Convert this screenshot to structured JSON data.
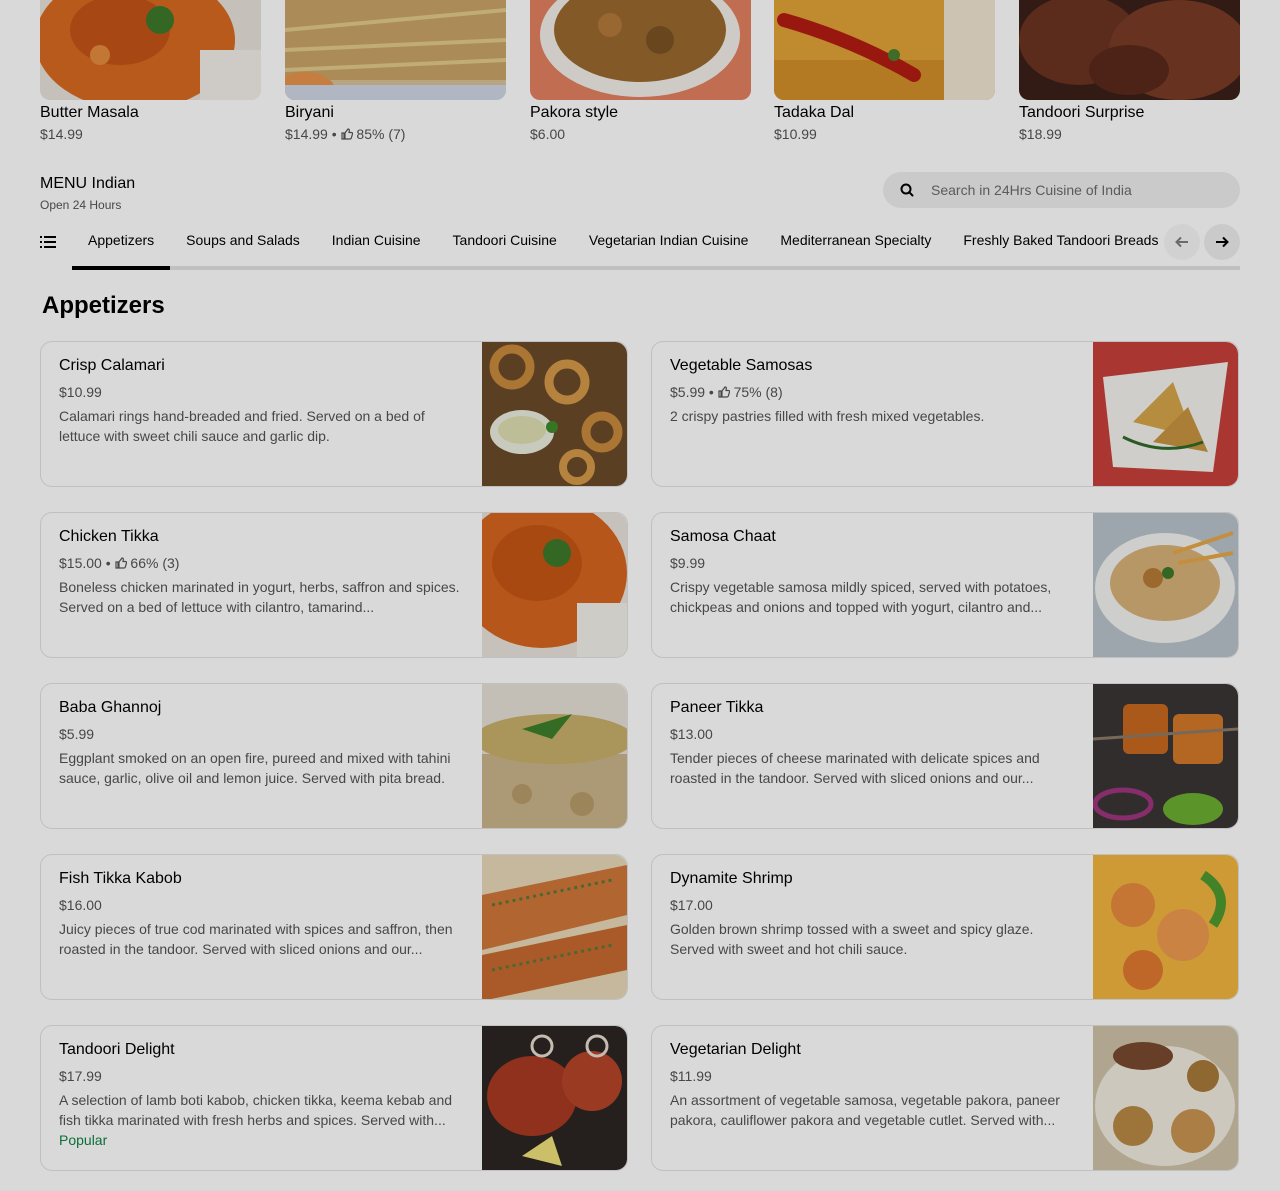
{
  "featured": [
    {
      "name": "Butter Masala",
      "meta": "$14.99",
      "rating": ""
    },
    {
      "name": "Biryani",
      "meta": "$14.99 •",
      "rating": "85% (7)"
    },
    {
      "name": "Pakora style",
      "meta": "$6.00",
      "rating": ""
    },
    {
      "name": "Tadaka Dal",
      "meta": "$10.99",
      "rating": ""
    },
    {
      "name": "Tandoori Surprise",
      "meta": "$18.99",
      "rating": ""
    }
  ],
  "menu": {
    "title": "MENU Indian",
    "hours": "Open 24 Hours",
    "search_placeholder": "Search in 24Hrs Cuisine of India"
  },
  "tabs": [
    {
      "label": "Appetizers"
    },
    {
      "label": "Soups and Salads"
    },
    {
      "label": "Indian Cuisine"
    },
    {
      "label": "Tandoori Cuisine"
    },
    {
      "label": "Vegetarian Indian Cuisine"
    },
    {
      "label": "Mediterranean Specialty"
    },
    {
      "label": "Freshly Baked Tandoori Breads"
    }
  ],
  "section": {
    "title": "Appetizers"
  },
  "items": [
    {
      "name": "Crisp Calamari",
      "price": "$10.99",
      "rating": "",
      "desc": "Calamari rings hand-breaded and fried. Served on a bed of lettuce with sweet chili sauce and garlic dip.",
      "badge": ""
    },
    {
      "name": "Vegetable Samosas",
      "price": "$5.99 •",
      "rating": "75% (8)",
      "desc": "2 crispy pastries filled with fresh mixed vegetables.",
      "badge": ""
    },
    {
      "name": "Chicken Tikka",
      "price": "$15.00 •",
      "rating": "66% (3)",
      "desc": "Boneless chicken marinated in yogurt, herbs, saffron and spices. Served on a bed of lettuce with cilantro, tamarind...",
      "badge": ""
    },
    {
      "name": "Samosa Chaat",
      "price": "$9.99",
      "rating": "",
      "desc": "Crispy vegetable samosa mildly spiced, served with potatoes, chickpeas and onions and topped with yogurt, cilantro and...",
      "badge": ""
    },
    {
      "name": "Baba Ghannoj",
      "price": "$5.99",
      "rating": "",
      "desc": "Eggplant smoked on an open fire, pureed and mixed with tahini sauce, garlic, olive oil and lemon juice. Served with pita bread.",
      "badge": ""
    },
    {
      "name": "Paneer Tikka",
      "price": "$13.00",
      "rating": "",
      "desc": "Tender pieces of cheese marinated with delicate spices and roasted in the tandoor. Served with sliced onions and our...",
      "badge": ""
    },
    {
      "name": "Fish Tikka Kabob",
      "price": "$16.00",
      "rating": "",
      "desc": "Juicy pieces of true cod marinated with spices and saffron, then roasted in the tandoor. Served with sliced onions and our...",
      "badge": ""
    },
    {
      "name": "Dynamite Shrimp",
      "price": "$17.00",
      "rating": "",
      "desc": "Golden brown shrimp tossed with a sweet and spicy glaze. Served with sweet and hot chili sauce.",
      "badge": ""
    },
    {
      "name": "Tandoori Delight",
      "price": "$17.99",
      "rating": "",
      "desc": "A selection of lamb boti kabob, chicken tikka, keema kebab and fish tikka marinated with fresh herbs and spices. Served with...",
      "badge": "Popular"
    },
    {
      "name": "Vegetarian Delight",
      "price": "$11.99",
      "rating": "",
      "desc": "An assortment of vegetable samosa, vegetable pakora, paneer pakora, cauliflower pakora and vegetable cutlet. Served with...",
      "badge": ""
    }
  ],
  "icons": {
    "search": "search-icon",
    "list": "list-icon",
    "prev": "arrow-left-icon",
    "next": "arrow-right-icon",
    "thumbs_up": "thumbs-up-icon"
  },
  "colors": {
    "text_primary": "#000000",
    "text_secondary": "#545454",
    "popular": "#0e8345",
    "chip_bg": "#eeeeee",
    "border": "#e2e2e2"
  }
}
